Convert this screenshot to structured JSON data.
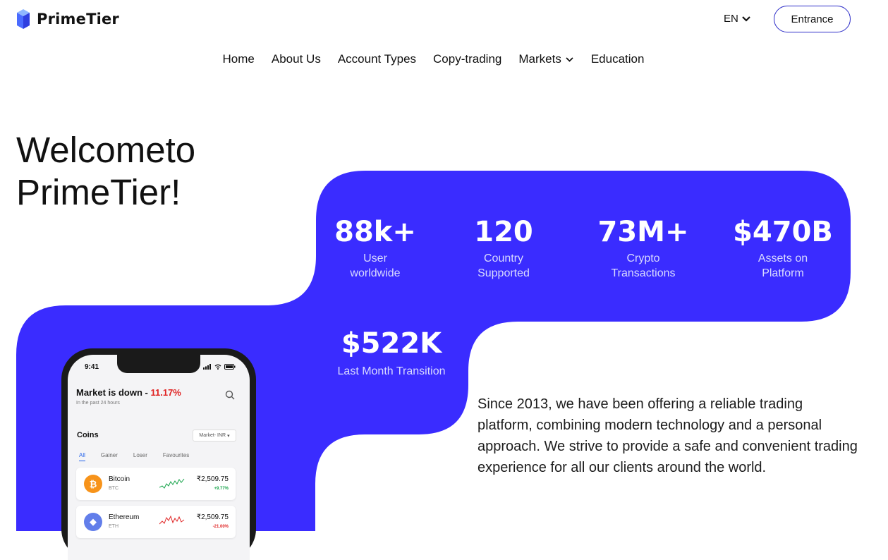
{
  "header": {
    "brand": "PrimeTier",
    "language": "EN",
    "entrance_label": "Entrance"
  },
  "nav": {
    "items": [
      "Home",
      "About Us",
      "Account Types",
      "Copy-trading",
      "Markets",
      "Education"
    ]
  },
  "hero": {
    "line1": "Welcometo",
    "line2": "PrimeTier!"
  },
  "stats": [
    {
      "value": "88k+",
      "label1": "User",
      "label2": "worldwide"
    },
    {
      "value": "120",
      "label1": "Country",
      "label2": "Supported"
    },
    {
      "value": "73M+",
      "label1": "Crypto",
      "label2": "Transactions"
    },
    {
      "value": "$470B",
      "label1": "Assets on",
      "label2": "Platform"
    },
    {
      "value": "$522K",
      "label1": "Last Month Transition"
    }
  ],
  "description": "Since 2013, we have been offering a reliable trading platform, combining modern technology and a personal approach. We strive to provide a safe and convenient trading experience for all our clients around the world.",
  "phone": {
    "time": "9:41",
    "market_title": "Market is down",
    "market_change": "11.17%",
    "market_sub": "In the past 24 hours",
    "coins_label": "Coins",
    "market_select": "Market- INR",
    "tabs": [
      "All",
      "Gainer",
      "Loser",
      "Favourites"
    ],
    "coins": [
      {
        "name": "Bitcoin",
        "symbol": "BTC",
        "price": "₹2,509.75",
        "change": "+9.77%"
      },
      {
        "name": "Ethereum",
        "symbol": "ETH",
        "price": "₹2,509.75",
        "change": "-21.00%"
      }
    ]
  },
  "colors": {
    "accent": "#3a2cff",
    "positive": "#16a34a",
    "negative": "#e02424"
  }
}
